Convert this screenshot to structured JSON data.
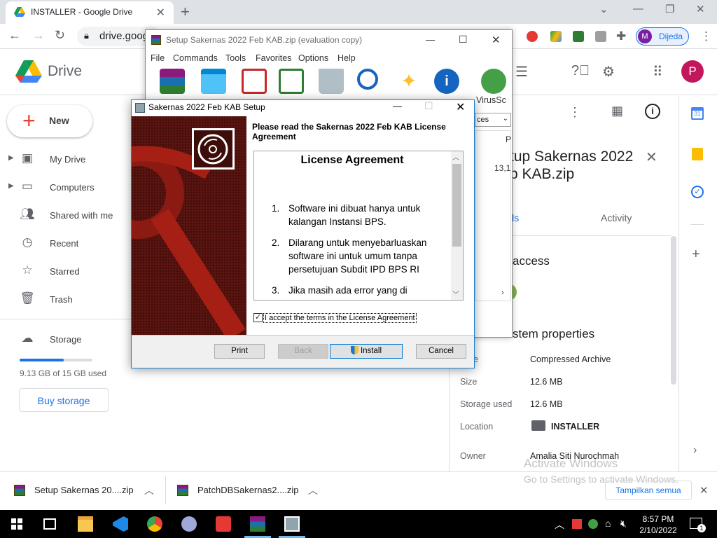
{
  "browser": {
    "tab_title": "INSTALLER - Google Drive",
    "url": "drive.goog",
    "profile_name": "Dijeda",
    "profile_initial": "M"
  },
  "drive": {
    "logo_text": "Drive",
    "avatar_initial": "P",
    "new_label": "New",
    "nav": [
      {
        "label": "My Drive"
      },
      {
        "label": "Computers"
      },
      {
        "label": "Shared with me"
      },
      {
        "label": "Recent"
      },
      {
        "label": "Starred"
      },
      {
        "label": "Trash"
      },
      {
        "label": "Storage"
      }
    ],
    "storage_used_text": "9.13 GB of 15 GB used",
    "storage_fraction": 0.61,
    "buy_storage": "Buy storage"
  },
  "details": {
    "title_line1": "tup Sakernas 2022",
    "title_line2": "b KAB.zip",
    "tab_details": "ils",
    "tab_activity": "Activity",
    "access_heading": "access",
    "props_heading": "stem properties",
    "type_key": "e",
    "props": [
      {
        "key": "Type",
        "value": "Compressed Archive"
      },
      {
        "key": "Size",
        "value": "12.6 MB"
      },
      {
        "key": "Storage used",
        "value": "12.6 MB"
      },
      {
        "key": "Location",
        "value": "INSTALLER"
      },
      {
        "key": "Owner",
        "value": "Amalia Siti Nurochmah"
      }
    ]
  },
  "downloads": {
    "items": [
      {
        "label": "Setup Sakernas 20....zip"
      },
      {
        "label": "PatchDBSakernas2....zip"
      }
    ],
    "show_all": "Tampilkan semua"
  },
  "watermark": {
    "line1": "Activate Windows",
    "line2": "Go to Settings to activate Windows."
  },
  "winrar": {
    "title": "Setup Sakernas 2022 Feb KAB.zip (evaluation copy)",
    "menu": [
      "File",
      "Commands",
      "Tools",
      "Favorites",
      "Options",
      "Help"
    ],
    "virus_label": "VirusSc",
    "dropdown_text": "ces",
    "col_p": "P",
    "size_value": "13,1"
  },
  "setup": {
    "title": "Sakernas 2022 Feb KAB Setup",
    "heading": "Please read the Sakernas 2022 Feb KAB License Agreement",
    "license_title": "License Agreement",
    "items": [
      {
        "num": "1.",
        "text": "Software ini dibuat hanya untuk kalangan Instansi BPS."
      },
      {
        "num": "2.",
        "text": "Dilarang untuk menyebarluaskan software ini untuk umum tanpa persetujuan Subdit IPD BPS RI"
      },
      {
        "num": "3.",
        "text": "Jika masih ada error yang di"
      }
    ],
    "accept_label": "I accept the terms in the License Agreement",
    "accepted": true,
    "buttons": {
      "print": "Print",
      "back": "Back",
      "install": "Install",
      "cancel": "Cancel"
    }
  },
  "taskbar": {
    "time": "8:57 PM",
    "date": "2/10/2022",
    "notification_count": "1"
  },
  "colors": {
    "drive_blue": "#1a73e8",
    "setup_banner": "#5a1410",
    "avatar_pink": "#c2185b"
  }
}
